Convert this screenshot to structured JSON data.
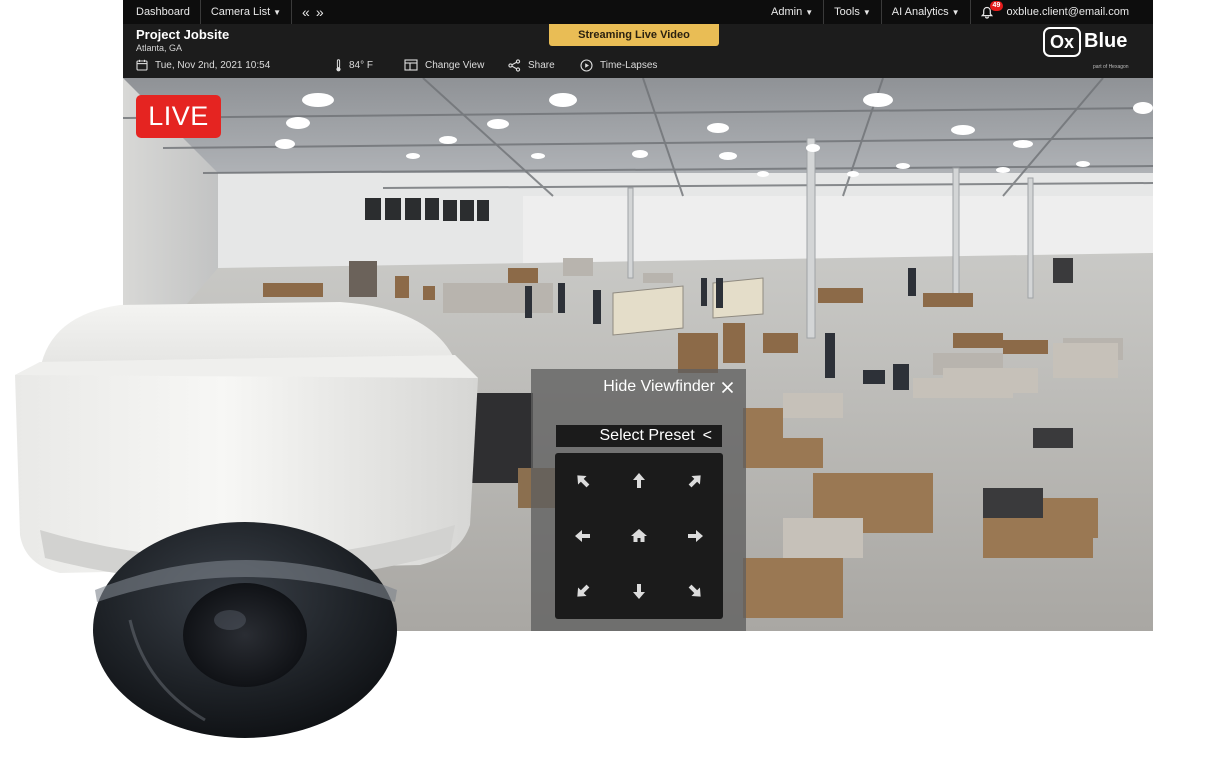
{
  "topnav": {
    "dashboard": "Dashboard",
    "camera_list": "Camera List",
    "prev_arrows": "«",
    "next_arrows": "»",
    "admin": "Admin",
    "tools": "Tools",
    "ai_analytics": "AI Analytics",
    "notifications": "49",
    "user_email": "oxblue.client@email.com"
  },
  "header": {
    "project_title": "Project Jobsite",
    "location": "Atlanta, GA",
    "streaming_badge": "Streaming Live Video",
    "datetime": "Tue, Nov 2nd, 2021 10:54",
    "temperature": "84° F",
    "change_view": "Change View",
    "share": "Share",
    "time_lapses": "Time-Lapses"
  },
  "logo": {
    "ox": "Ox",
    "blue": "Blue",
    "tagline": "part of Hexagon"
  },
  "video": {
    "live_label": "LIVE"
  },
  "viewfinder": {
    "hide_label": "Hide Viewfinder",
    "select_preset": "Select Preset",
    "preset_chevron": "<"
  },
  "colors": {
    "live_red": "#e52421",
    "streaming_gold": "#e9bd55",
    "nav_bg": "#0d0d0d",
    "header_bg": "#1c1c1c",
    "badge_red": "#e31b1b"
  },
  "icons": {
    "bell": "bell-icon",
    "calendar": "calendar-icon",
    "thermometer": "thermometer-icon",
    "change_view": "layout-icon",
    "share": "share-icon",
    "time_lapse": "play-circle-icon",
    "close": "close-icon",
    "home": "home-icon"
  }
}
